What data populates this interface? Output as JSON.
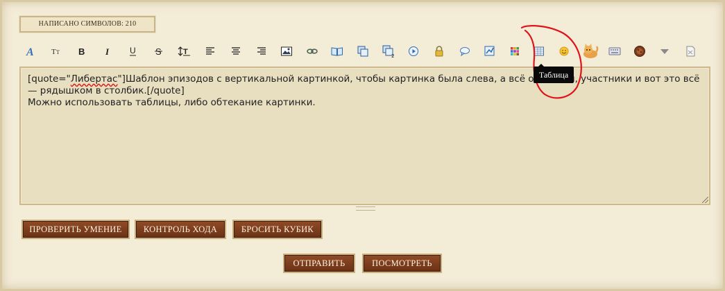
{
  "counter": {
    "text": "НАПИСАНО СИМВОЛОВ: 210"
  },
  "toolbar": {
    "buttons": [
      {
        "name": "font-icon",
        "glyph": "A"
      },
      {
        "name": "font-size-icon",
        "glyph": "Tт"
      },
      {
        "name": "bold-icon",
        "glyph": "B"
      },
      {
        "name": "italic-icon",
        "glyph": "I"
      },
      {
        "name": "underline-icon",
        "glyph": "U"
      },
      {
        "name": "strikethrough-icon",
        "glyph": "S"
      },
      {
        "name": "text-height-icon",
        "glyph": ""
      },
      {
        "name": "align-left-icon",
        "glyph": ""
      },
      {
        "name": "align-center-icon",
        "glyph": ""
      },
      {
        "name": "align-right-icon",
        "glyph": ""
      },
      {
        "name": "image-icon",
        "glyph": ""
      },
      {
        "name": "link-icon",
        "glyph": ""
      },
      {
        "name": "book-icon",
        "glyph": ""
      },
      {
        "name": "copy-icon",
        "glyph": ""
      },
      {
        "name": "copy-2-icon",
        "glyph": ""
      },
      {
        "name": "play-icon",
        "glyph": ""
      },
      {
        "name": "lock-icon",
        "glyph": ""
      },
      {
        "name": "speech-bubble-icon",
        "glyph": ""
      },
      {
        "name": "chart-icon",
        "glyph": ""
      },
      {
        "name": "color-palette-icon",
        "glyph": ""
      },
      {
        "name": "table-icon",
        "glyph": ""
      },
      {
        "name": "smiley-icon",
        "glyph": ""
      },
      {
        "name": "cat-icon",
        "glyph": ""
      },
      {
        "name": "keyboard-icon",
        "glyph": ""
      },
      {
        "name": "cookie-icon",
        "glyph": ""
      },
      {
        "name": "dropdown-arrow-icon",
        "glyph": ""
      },
      {
        "name": "clear-icon",
        "glyph": ""
      }
    ]
  },
  "tooltip": {
    "text": "Таблица"
  },
  "editor": {
    "quote_open": "[quote=\"",
    "quote_author": "Либертас",
    "quote_rest": "\"]Шаблон эпизодов с вертикальной картинкой, чтобы картинка была слева, а всё описания, участники и вот это всё — рядышком в столбик.[/quote]",
    "line2": "Можно использовать таблицы, либо обтекание картинки."
  },
  "actions": {
    "check_skill": "ПРОВЕРИТЬ УМЕНИЕ",
    "turn_control": "КОНТРОЛЬ ХОДА",
    "roll_dice": "БРОСИТЬ КУБИК",
    "submit": "ОТПРАВИТЬ",
    "preview": "ПОСМОТРЕТЬ"
  },
  "colors": {
    "background": "#f3ecd7",
    "editor_bg": "#e8dec0",
    "button_brown": "#7a3a1c",
    "annotation_red": "#e0121a",
    "tooltip_bg": "#0a0a0a"
  }
}
